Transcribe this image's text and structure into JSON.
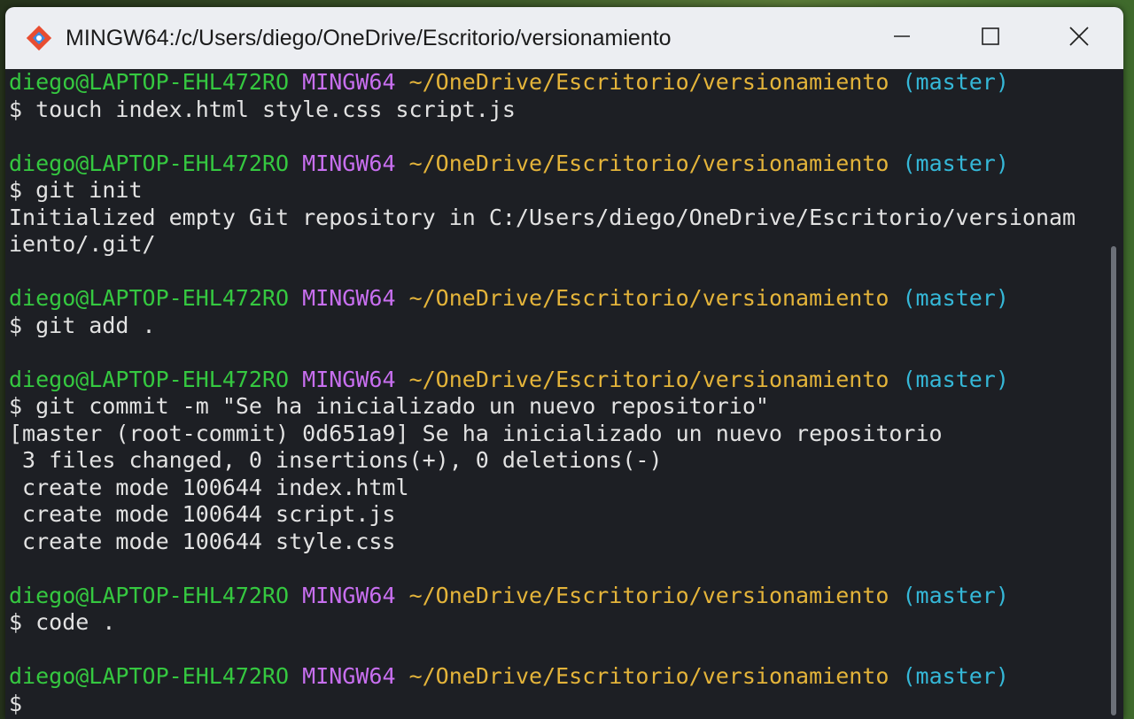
{
  "window": {
    "title": "MINGW64:/c/Users/diego/OneDrive/Escritorio/versionamiento",
    "icon": "git-bash-icon",
    "controls": [
      "minimize-icon",
      "maximize-icon",
      "close-icon"
    ]
  },
  "prompt": {
    "user": "diego@LAPTOP-EHL472RO",
    "system": "MINGW64",
    "path": "~/OneDrive/Escritorio/versionamiento",
    "branch": "(master)"
  },
  "colors": {
    "user": "#35c840",
    "system": "#c86ff0",
    "path": "#e4b43a",
    "branch": "#35b8d8",
    "background": "#1d1f24"
  },
  "blocks": [
    {
      "command": "$ touch index.html style.css script.js",
      "output": []
    },
    {
      "command": "$ git init",
      "output": [
        "Initialized empty Git repository in C:/Users/diego/OneDrive/Escritorio/versionam",
        "iento/.git/"
      ]
    },
    {
      "command": "$ git add .",
      "output": []
    },
    {
      "command": "$ git commit -m \"Se ha inicializado un nuevo repositorio\"",
      "output": [
        "[master (root-commit) 0d651a9] Se ha inicializado un nuevo repositorio",
        " 3 files changed, 0 insertions(+), 0 deletions(-)",
        " create mode 100644 index.html",
        " create mode 100644 script.js",
        " create mode 100644 style.css"
      ]
    },
    {
      "command": "$ code .",
      "output": []
    },
    {
      "command": "$",
      "output": []
    }
  ]
}
